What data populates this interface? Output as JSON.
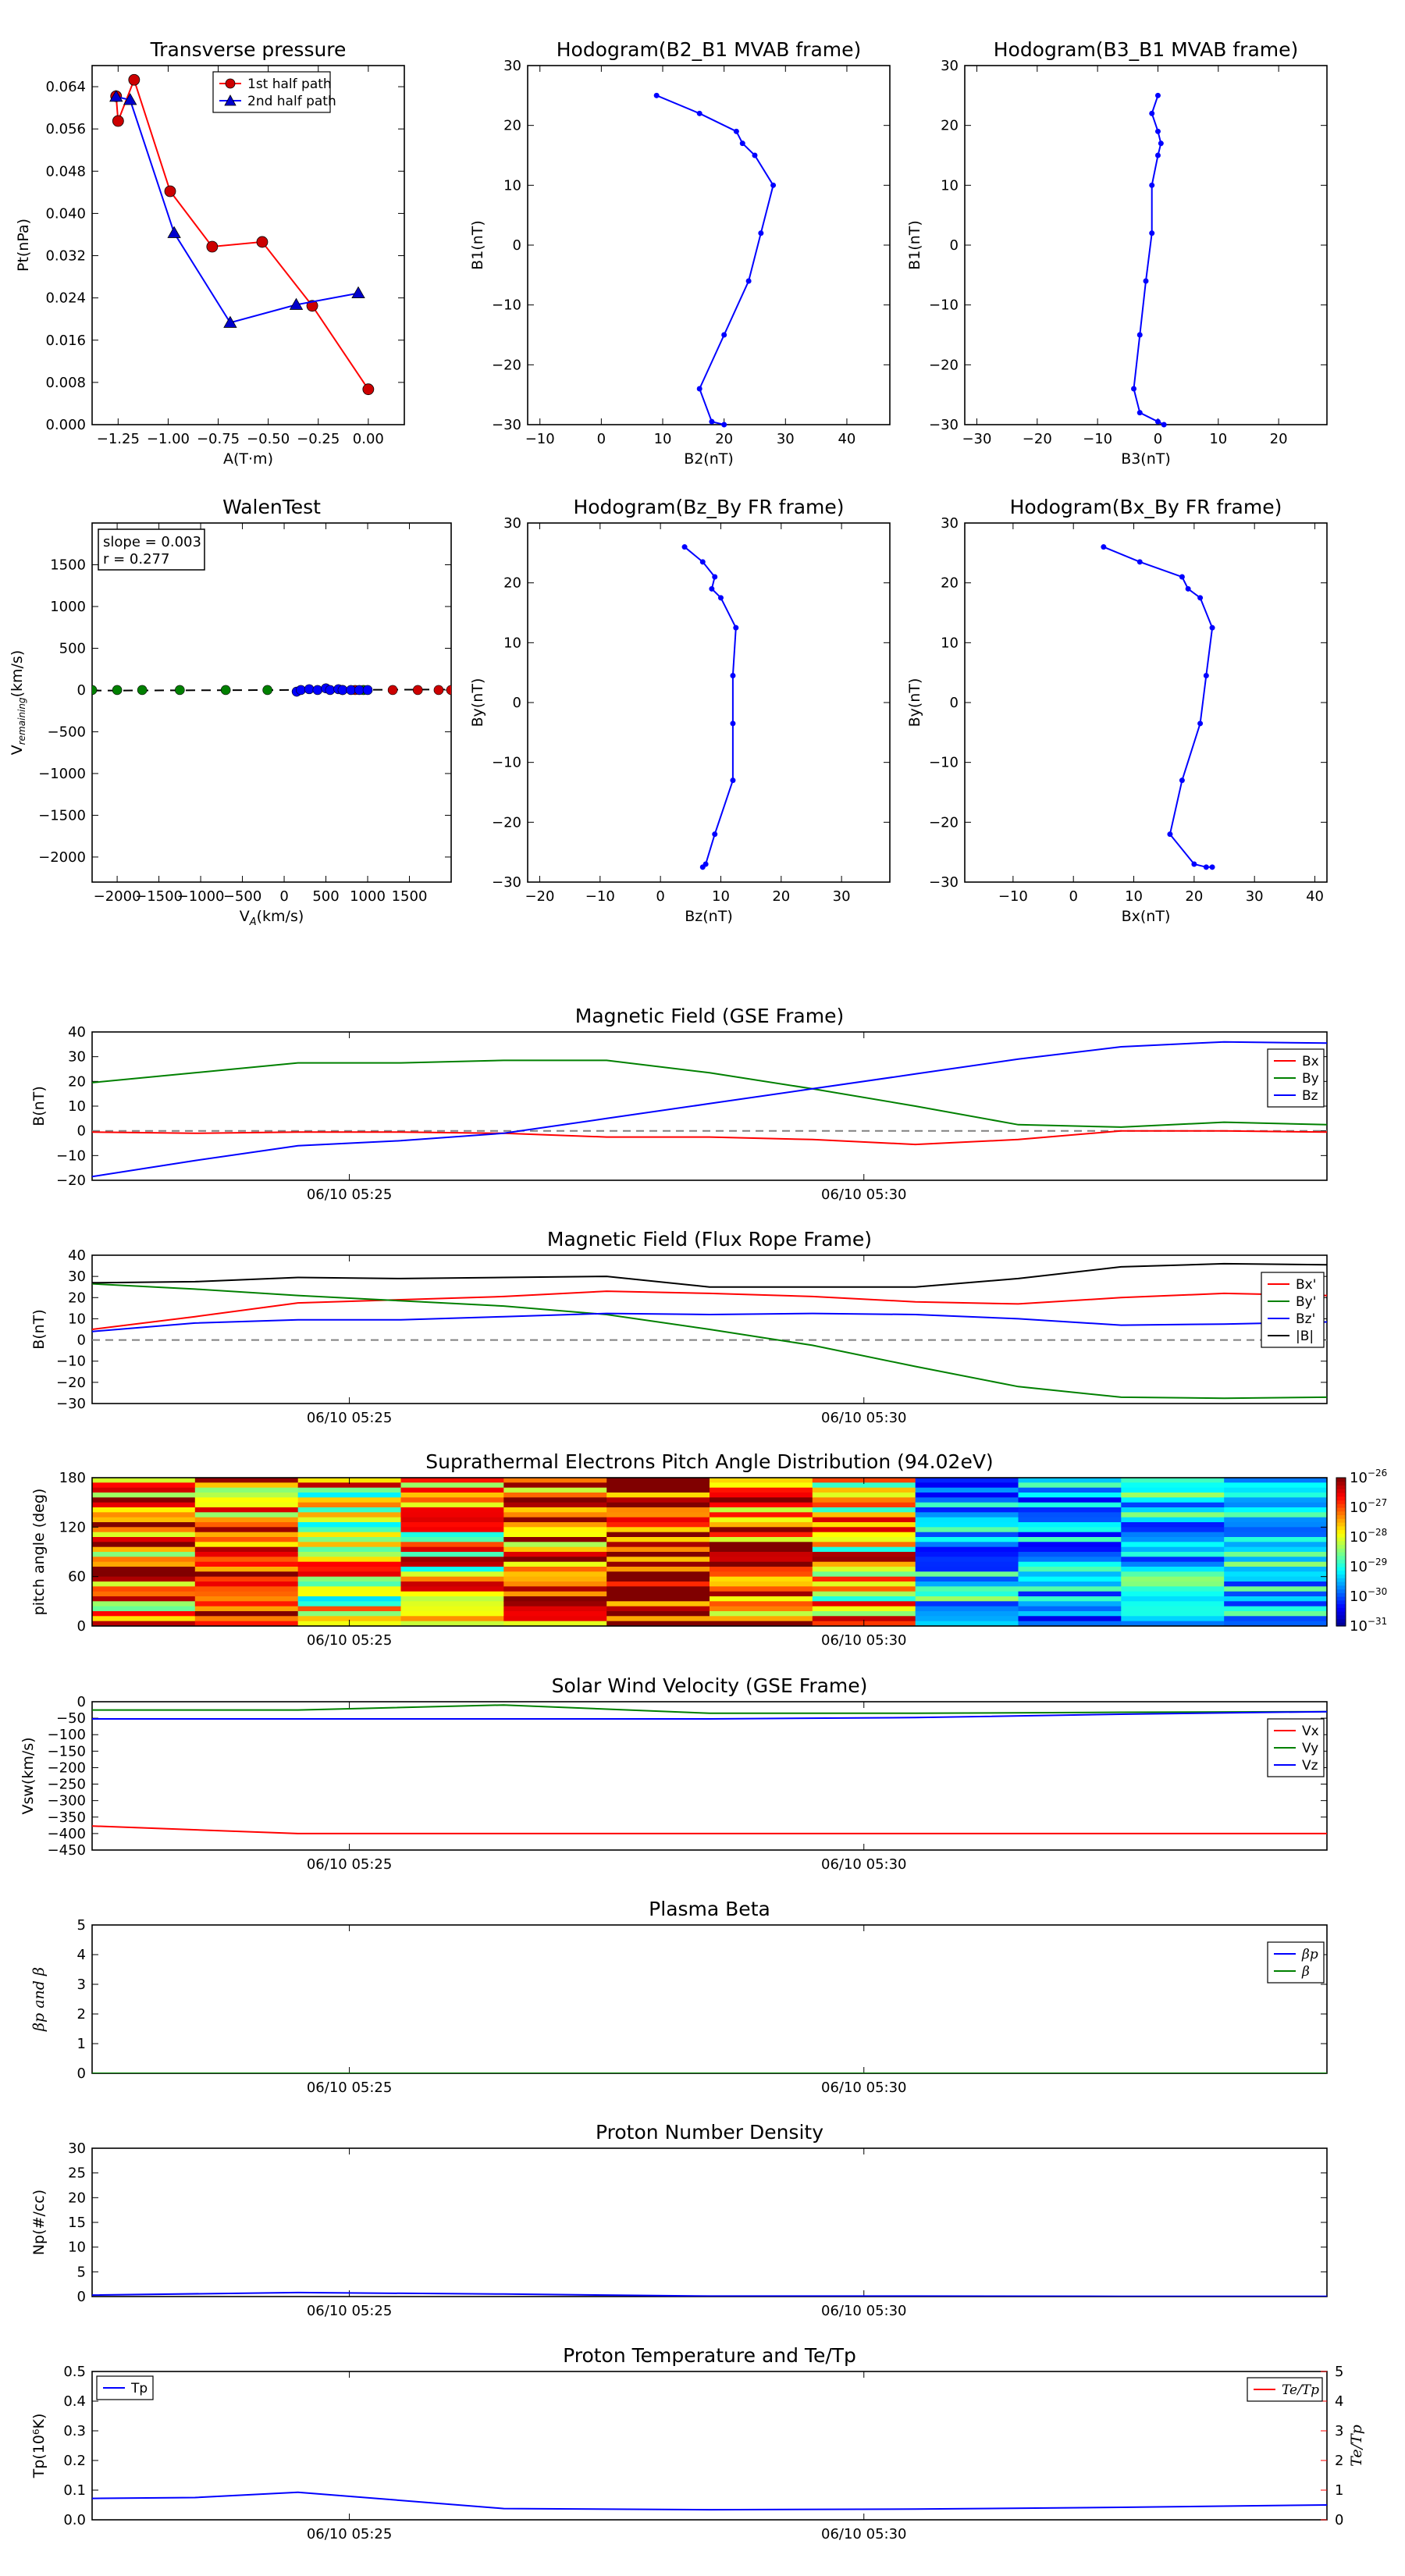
{
  "figure": {
    "background": "#ffffff"
  },
  "chart_data": [
    {
      "id": "transverse-pressure",
      "type": "line",
      "title": "Transverse pressure",
      "xlabel": "A(T·m)",
      "ylabel": "Pt(nPa)",
      "xlim": [
        -1.38,
        0.18
      ],
      "ylim": [
        0,
        0.068
      ],
      "xticks": [
        -1.25,
        -1.0,
        -0.75,
        -0.5,
        -0.25,
        0.0
      ],
      "xtick_labels": [
        "−1.25",
        "−1.00",
        "−0.75",
        "−0.50",
        "−0.25",
        "0.00"
      ],
      "yticks": [
        0,
        0.008,
        0.016,
        0.024,
        0.032,
        0.04,
        0.048,
        0.056,
        0.064
      ],
      "ytick_labels": [
        "0.000",
        "0.008",
        "0.016",
        "0.024",
        "0.032",
        "0.040",
        "0.048",
        "0.056",
        "0.064"
      ],
      "legend": {
        "position": "top-center",
        "entries": [
          "1st half path",
          "2nd half path"
        ]
      },
      "series": [
        {
          "name": "1st half path",
          "color": "#ff0000",
          "marker": "circle",
          "marker_fill": "#cc0000",
          "x": [
            0.0,
            -0.28,
            -0.53,
            -0.78,
            -0.99,
            -1.17,
            -1.25,
            -1.26
          ],
          "y": [
            0.0067,
            0.0225,
            0.0346,
            0.0337,
            0.0442,
            0.0653,
            0.0575,
            0.0622
          ]
        },
        {
          "name": "2nd half path",
          "color": "#0000ff",
          "marker": "triangle",
          "marker_fill": "#0000cc",
          "x": [
            -0.05,
            -0.36,
            -0.69,
            -0.97,
            -1.19,
            -1.26
          ],
          "y": [
            0.0249,
            0.0227,
            0.0193,
            0.0363,
            0.0615,
            0.0621
          ]
        }
      ]
    },
    {
      "id": "hodogram-b2-b1",
      "type": "line",
      "title": "Hodogram(B2_B1 MVAB frame)",
      "xlabel": "B2(nT)",
      "ylabel": "B1(nT)",
      "xlim": [
        -12,
        47
      ],
      "ylim": [
        -30,
        30
      ],
      "xticks": [
        -10,
        0,
        10,
        20,
        30,
        40
      ],
      "yticks": [
        -30,
        -20,
        -10,
        0,
        10,
        20,
        30
      ],
      "series": [
        {
          "color": "#0000ff",
          "x": [
            9,
            16,
            22,
            23,
            25,
            28,
            26,
            24,
            20,
            16,
            18,
            20
          ],
          "y": [
            25,
            22,
            19,
            17,
            15,
            10,
            2,
            -6,
            -15,
            -24,
            -29.5,
            -30
          ]
        }
      ]
    },
    {
      "id": "hodogram-b3-b1",
      "type": "line",
      "title": "Hodogram(B3_B1 MVAB frame)",
      "xlabel": "B3(nT)",
      "ylabel": "B1(nT)",
      "xlim": [
        -32,
        28
      ],
      "ylim": [
        -30,
        30
      ],
      "xticks": [
        -30,
        -20,
        -10,
        0,
        10,
        20
      ],
      "yticks": [
        -30,
        -20,
        -10,
        0,
        10,
        20,
        30
      ],
      "series": [
        {
          "color": "#0000ff",
          "x": [
            0,
            -1,
            0,
            0.5,
            0,
            -1,
            -1,
            -2,
            -3,
            -4,
            -3,
            0,
            1
          ],
          "y": [
            25,
            22,
            19,
            17,
            15,
            10,
            2,
            -6,
            -15,
            -24,
            -28,
            -29.5,
            -30
          ]
        }
      ]
    },
    {
      "id": "walen-test",
      "type": "scatter",
      "title": "WalenTest",
      "xlabel": "V_A(km/s)",
      "ylabel": "V_remaining(km/s)",
      "xlim": [
        -2300,
        2000
      ],
      "ylim": [
        -2300,
        2000
      ],
      "xticks": [
        -2000,
        -1500,
        -1000,
        -500,
        0,
        500,
        1000,
        1500
      ],
      "yticks": [
        -2000,
        -1500,
        -1000,
        -500,
        0,
        500,
        1000,
        1500
      ],
      "annotation_lines": [
        "slope = 0.003",
        "r = 0.277"
      ],
      "fit_line": {
        "slope": 0.003,
        "intercept": 0,
        "style": "dashed",
        "color": "#000000"
      },
      "series": [
        {
          "color": "#008000",
          "x": [
            -2300,
            -2000,
            -1700,
            -1250,
            -700,
            -200,
            950
          ],
          "y": [
            0,
            0,
            0,
            0,
            0,
            0,
            0
          ]
        },
        {
          "color": "#cc0000",
          "x": [
            700,
            850,
            1300,
            1600,
            1850,
            2000
          ],
          "y": [
            0,
            0,
            0,
            0,
            0,
            0
          ]
        },
        {
          "color": "#0000ff",
          "x": [
            150,
            200,
            300,
            400,
            500,
            550,
            650,
            700,
            800,
            900,
            1000
          ],
          "y": [
            -20,
            0,
            10,
            0,
            20,
            0,
            10,
            0,
            0,
            0,
            0
          ]
        }
      ]
    },
    {
      "id": "hodogram-bz-by",
      "type": "line",
      "title": "Hodogram(Bz_By FR frame)",
      "xlabel": "Bz(nT)",
      "ylabel": "By(nT)",
      "xlim": [
        -22,
        38
      ],
      "ylim": [
        -30,
        30
      ],
      "xticks": [
        -20,
        -10,
        0,
        10,
        20,
        30
      ],
      "yticks": [
        -30,
        -20,
        -10,
        0,
        10,
        20,
        30
      ],
      "series": [
        {
          "color": "#0000ff",
          "x": [
            4,
            7,
            9,
            8.5,
            10,
            12.5,
            12,
            12,
            12,
            9,
            7.5,
            7
          ],
          "y": [
            26,
            23.5,
            21,
            19,
            17.5,
            12.5,
            4.5,
            -3.5,
            -13,
            -22,
            -27,
            -27.5
          ]
        }
      ]
    },
    {
      "id": "hodogram-bx-by",
      "type": "line",
      "title": "Hodogram(Bx_By FR frame)",
      "xlabel": "Bx(nT)",
      "ylabel": "By(nT)",
      "xlim": [
        -18,
        42
      ],
      "ylim": [
        -30,
        30
      ],
      "xticks": [
        -10,
        0,
        10,
        20,
        30,
        40
      ],
      "yticks": [
        -30,
        -20,
        -10,
        0,
        10,
        20,
        30
      ],
      "series": [
        {
          "color": "#0000ff",
          "x": [
            5,
            11,
            18,
            19,
            21,
            23,
            22,
            21,
            18,
            16,
            20,
            22,
            23
          ],
          "y": [
            26,
            23.5,
            21,
            19,
            17.5,
            12.5,
            4.5,
            -3.5,
            -13,
            -22,
            -27,
            -27.5,
            -27.5
          ]
        }
      ]
    },
    {
      "id": "magnetic-field-gse",
      "type": "line",
      "title": "Magnetic Field (GSE Frame)",
      "ylabel": "B(nT)",
      "x_min": [
        0,
        12
      ],
      "ylim": [
        -20,
        40
      ],
      "yticks": [
        -20,
        -10,
        0,
        10,
        20,
        30,
        40
      ],
      "xtick_pos": [
        2.5,
        7.5
      ],
      "xtick_labels": [
        "06/10 05:25",
        "06/10 05:30"
      ],
      "zero_line": true,
      "legend": {
        "position": "top-right",
        "entries": [
          "Bx",
          "By",
          "Bz"
        ]
      },
      "x": [
        0,
        1,
        2,
        3,
        4,
        5,
        6,
        7,
        8,
        9,
        10,
        11,
        12
      ],
      "series": [
        {
          "name": "Bx",
          "color": "#ff0000",
          "values": [
            -0.5,
            -1,
            -0.5,
            -0.5,
            -1,
            -2.5,
            -2.5,
            -3.5,
            -5.5,
            -3.5,
            0,
            0,
            -0.5
          ]
        },
        {
          "name": "By",
          "color": "#008000",
          "values": [
            19.5,
            23.5,
            27.5,
            27.5,
            28.5,
            28.5,
            23.5,
            17,
            10,
            2.5,
            1.5,
            3.5,
            2.5
          ]
        },
        {
          "name": "Bz",
          "color": "#0000ff",
          "values": [
            -18.5,
            -12,
            -6,
            -4,
            -1,
            5,
            11,
            17,
            23,
            29,
            34,
            36,
            35.5
          ]
        }
      ]
    },
    {
      "id": "magnetic-field-fr",
      "type": "line",
      "title": "Magnetic Field (Flux Rope Frame)",
      "ylabel": "B(nT)",
      "x_min": [
        0,
        12
      ],
      "ylim": [
        -30,
        40
      ],
      "yticks": [
        -30,
        -20,
        -10,
        0,
        10,
        20,
        30,
        40
      ],
      "xtick_pos": [
        2.5,
        7.5
      ],
      "xtick_labels": [
        "06/10 05:25",
        "06/10 05:30"
      ],
      "zero_line": true,
      "legend": {
        "position": "top-right",
        "entries": [
          "Bx'",
          "By'",
          "Bz'",
          "|B|"
        ]
      },
      "x": [
        0,
        1,
        2,
        3,
        4,
        5,
        6,
        7,
        8,
        9,
        10,
        11,
        12
      ],
      "series": [
        {
          "name": "Bx'",
          "color": "#ff0000",
          "values": [
            5,
            11,
            17.5,
            19,
            20.5,
            23,
            22,
            20.5,
            18,
            17,
            20,
            22,
            21
          ]
        },
        {
          "name": "By'",
          "color": "#008000",
          "values": [
            26.5,
            24,
            21,
            18.5,
            16,
            12,
            5,
            -2.5,
            -12.5,
            -22,
            -27,
            -27.5,
            -27
          ]
        },
        {
          "name": "Bz'",
          "color": "#0000ff",
          "values": [
            4,
            8,
            9.5,
            9.5,
            11,
            12.5,
            12,
            12.5,
            12,
            10,
            7,
            7.5,
            8.5
          ]
        },
        {
          "name": "|B|",
          "color": "#000000",
          "values": [
            27,
            27.5,
            29.5,
            29,
            29.5,
            30,
            25,
            25,
            25,
            29,
            34.5,
            36,
            35.5
          ]
        }
      ]
    },
    {
      "id": "pitch-angle-distribution",
      "type": "heatmap",
      "title": "Suprathermal Electrons Pitch Angle Distribution (94.02eV)",
      "ylabel": "pitch angle (deg)",
      "x_min": [
        0,
        12
      ],
      "ylim": [
        0,
        180
      ],
      "yticks": [
        0,
        60,
        120,
        180
      ],
      "xtick_pos": [
        2.5,
        7.5
      ],
      "xtick_labels": [
        "06/10 05:25",
        "06/10 05:30"
      ],
      "colorbar": {
        "scale": "log",
        "min_exp": -31,
        "max_exp": -26,
        "tick_exps": [
          -31,
          -30,
          -29,
          -28,
          -27,
          -26
        ]
      },
      "columns": [
        {
          "seed": 3,
          "level": -27.3,
          "spread": 1.5
        },
        {
          "seed": 11,
          "level": -27.1,
          "spread": 1.4
        },
        {
          "seed": 19,
          "level": -27.7,
          "spread": 1.6
        },
        {
          "seed": 23,
          "level": -27.6,
          "spread": 1.5
        },
        {
          "seed": 31,
          "level": -27.0,
          "spread": 1.3
        },
        {
          "seed": 37,
          "level": -26.8,
          "spread": 1.3
        },
        {
          "seed": 41,
          "level": -26.9,
          "spread": 1.3
        },
        {
          "seed": 47,
          "level": -27.5,
          "spread": 1.6
        },
        {
          "seed": 53,
          "level": -29.4,
          "spread": 1.1
        },
        {
          "seed": 59,
          "level": -29.6,
          "spread": 0.9
        },
        {
          "seed": 61,
          "level": -29.4,
          "spread": 1.1
        },
        {
          "seed": 67,
          "level": -29.3,
          "spread": 0.9
        }
      ]
    },
    {
      "id": "solar-wind-velocity",
      "type": "line",
      "title": "Solar Wind Velocity (GSE Frame)",
      "ylabel": "Vsw(km/s)",
      "x_min": [
        0,
        12
      ],
      "ylim": [
        -450,
        0
      ],
      "yticks": [
        -450,
        -400,
        -350,
        -300,
        -250,
        -200,
        -150,
        -100,
        -50,
        0
      ],
      "xtick_pos": [
        2.5,
        7.5
      ],
      "xtick_labels": [
        "06/10 05:25",
        "06/10 05:30"
      ],
      "legend": {
        "position": "top-right",
        "entries": [
          "Vx",
          "Vy",
          "Vz"
        ]
      },
      "x": [
        0,
        2,
        4,
        6,
        8,
        10,
        12
      ],
      "series": [
        {
          "name": "Vx",
          "color": "#ff0000",
          "values": [
            -377,
            -400,
            -400,
            -400,
            -400,
            -400,
            -400
          ]
        },
        {
          "name": "Vy",
          "color": "#008000",
          "values": [
            -25,
            -25,
            -10,
            -35,
            -35,
            -32,
            -30
          ]
        },
        {
          "name": "Vz",
          "color": "#0000ff",
          "values": [
            -52,
            -52,
            -52,
            -52,
            -48,
            -38,
            -30
          ]
        }
      ]
    },
    {
      "id": "plasma-beta",
      "type": "line",
      "title": "Plasma Beta",
      "ylabel": "βp and β",
      "x_min": [
        0,
        12
      ],
      "ylim": [
        0,
        5
      ],
      "yticks": [
        0,
        1,
        2,
        3,
        4,
        5
      ],
      "xtick_pos": [
        2.5,
        7.5
      ],
      "xtick_labels": [
        "06/10 05:25",
        "06/10 05:30"
      ],
      "legend": {
        "position": "top-right",
        "entries": [
          "βp",
          "β"
        ]
      },
      "x": [
        0,
        12
      ],
      "series": [
        {
          "name": "βp",
          "color": "#0000ff",
          "values": [
            0,
            0
          ]
        },
        {
          "name": "β",
          "color": "#008000",
          "values": [
            0,
            0
          ]
        }
      ]
    },
    {
      "id": "proton-density",
      "type": "line",
      "title": "Proton Number Density",
      "ylabel": "Np(#/cc)",
      "x_min": [
        0,
        12
      ],
      "ylim": [
        0,
        30
      ],
      "yticks": [
        0,
        5,
        10,
        15,
        20,
        25,
        30
      ],
      "xtick_pos": [
        2.5,
        7.5
      ],
      "xtick_labels": [
        "06/10 05:25",
        "06/10 05:30"
      ],
      "x": [
        0,
        2,
        4,
        6,
        8,
        10,
        12
      ],
      "series": [
        {
          "color": "#0000ff",
          "values": [
            0.3,
            0.8,
            0.5,
            0.1,
            0.1,
            0.05,
            0.05
          ]
        }
      ]
    },
    {
      "id": "proton-temperature",
      "type": "line",
      "title": "Proton Temperature and Te/Tp",
      "ylabel": "Tp(10⁶K)",
      "y2label": "Te/Tp",
      "x_min": [
        0,
        12
      ],
      "ylim": [
        0,
        0.5
      ],
      "y2lim": [
        0,
        5
      ],
      "yticks": [
        0,
        0.1,
        0.2,
        0.3,
        0.4,
        0.5
      ],
      "ytick_labels": [
        "0.0",
        "0.1",
        "0.2",
        "0.3",
        "0.4",
        "0.5"
      ],
      "y2ticks": [
        0,
        1,
        2,
        3,
        4,
        5
      ],
      "xtick_pos": [
        2.5,
        7.5
      ],
      "xtick_labels": [
        "06/10 05:25",
        "06/10 05:30"
      ],
      "legend": {
        "position": "top-left",
        "entries": [
          "Tp"
        ]
      },
      "legend2": {
        "position": "top-right",
        "entries": [
          "Te/Tp"
        ]
      },
      "y2_color": "#ff0000",
      "x": [
        0,
        1,
        2,
        4,
        6,
        8,
        10,
        12
      ],
      "series": [
        {
          "name": "Tp",
          "color": "#0000ff",
          "values": [
            0.072,
            0.075,
            0.093,
            0.038,
            0.034,
            0.036,
            0.042,
            0.05
          ]
        }
      ]
    }
  ]
}
